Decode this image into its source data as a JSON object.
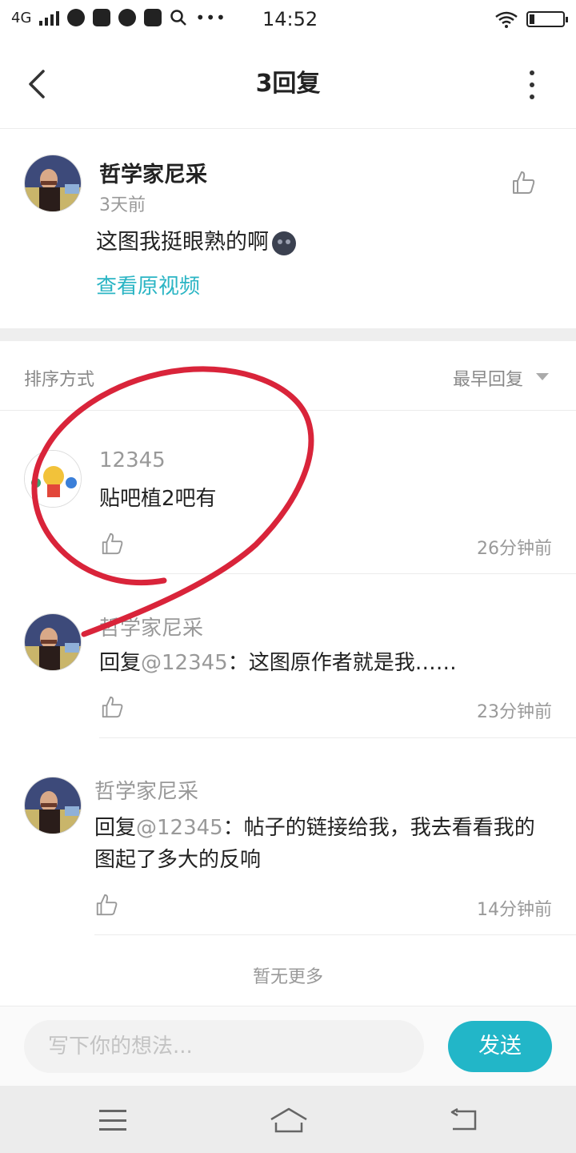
{
  "status_bar": {
    "network": "4G",
    "time": "14:52"
  },
  "header": {
    "title": "3回复"
  },
  "main_post": {
    "author": "哲学家尼采",
    "time": "3天前",
    "text": "这图我挺眼熟的啊",
    "view_video_label": "查看原视频"
  },
  "sort": {
    "label": "排序方式",
    "value": "最早回复"
  },
  "replies": [
    {
      "author": "12345",
      "text": "贴吧植2吧有",
      "time": "26分钟前"
    },
    {
      "author": "哲学家尼采",
      "reply_prefix": "回复",
      "mention": "@12345",
      "text": "：这图原作者就是我……",
      "time": "23分钟前"
    },
    {
      "author": "哲学家尼采",
      "reply_prefix": "回复",
      "mention": "@12345",
      "text": "：帖子的链接给我，我去看看我的图起了多大的反响",
      "time": "14分钟前"
    }
  ],
  "no_more": "暂无更多",
  "composer": {
    "placeholder": "写下你的想法...",
    "send_label": "发送"
  },
  "colors": {
    "accent": "#22b6c8",
    "link": "#2bb5c4",
    "annotation": "#d9243a"
  },
  "icons": {
    "back": "chevron-left-icon",
    "more": "more-vertical-icon",
    "like": "thumbs-up-icon",
    "sort": "caret-down-icon"
  }
}
